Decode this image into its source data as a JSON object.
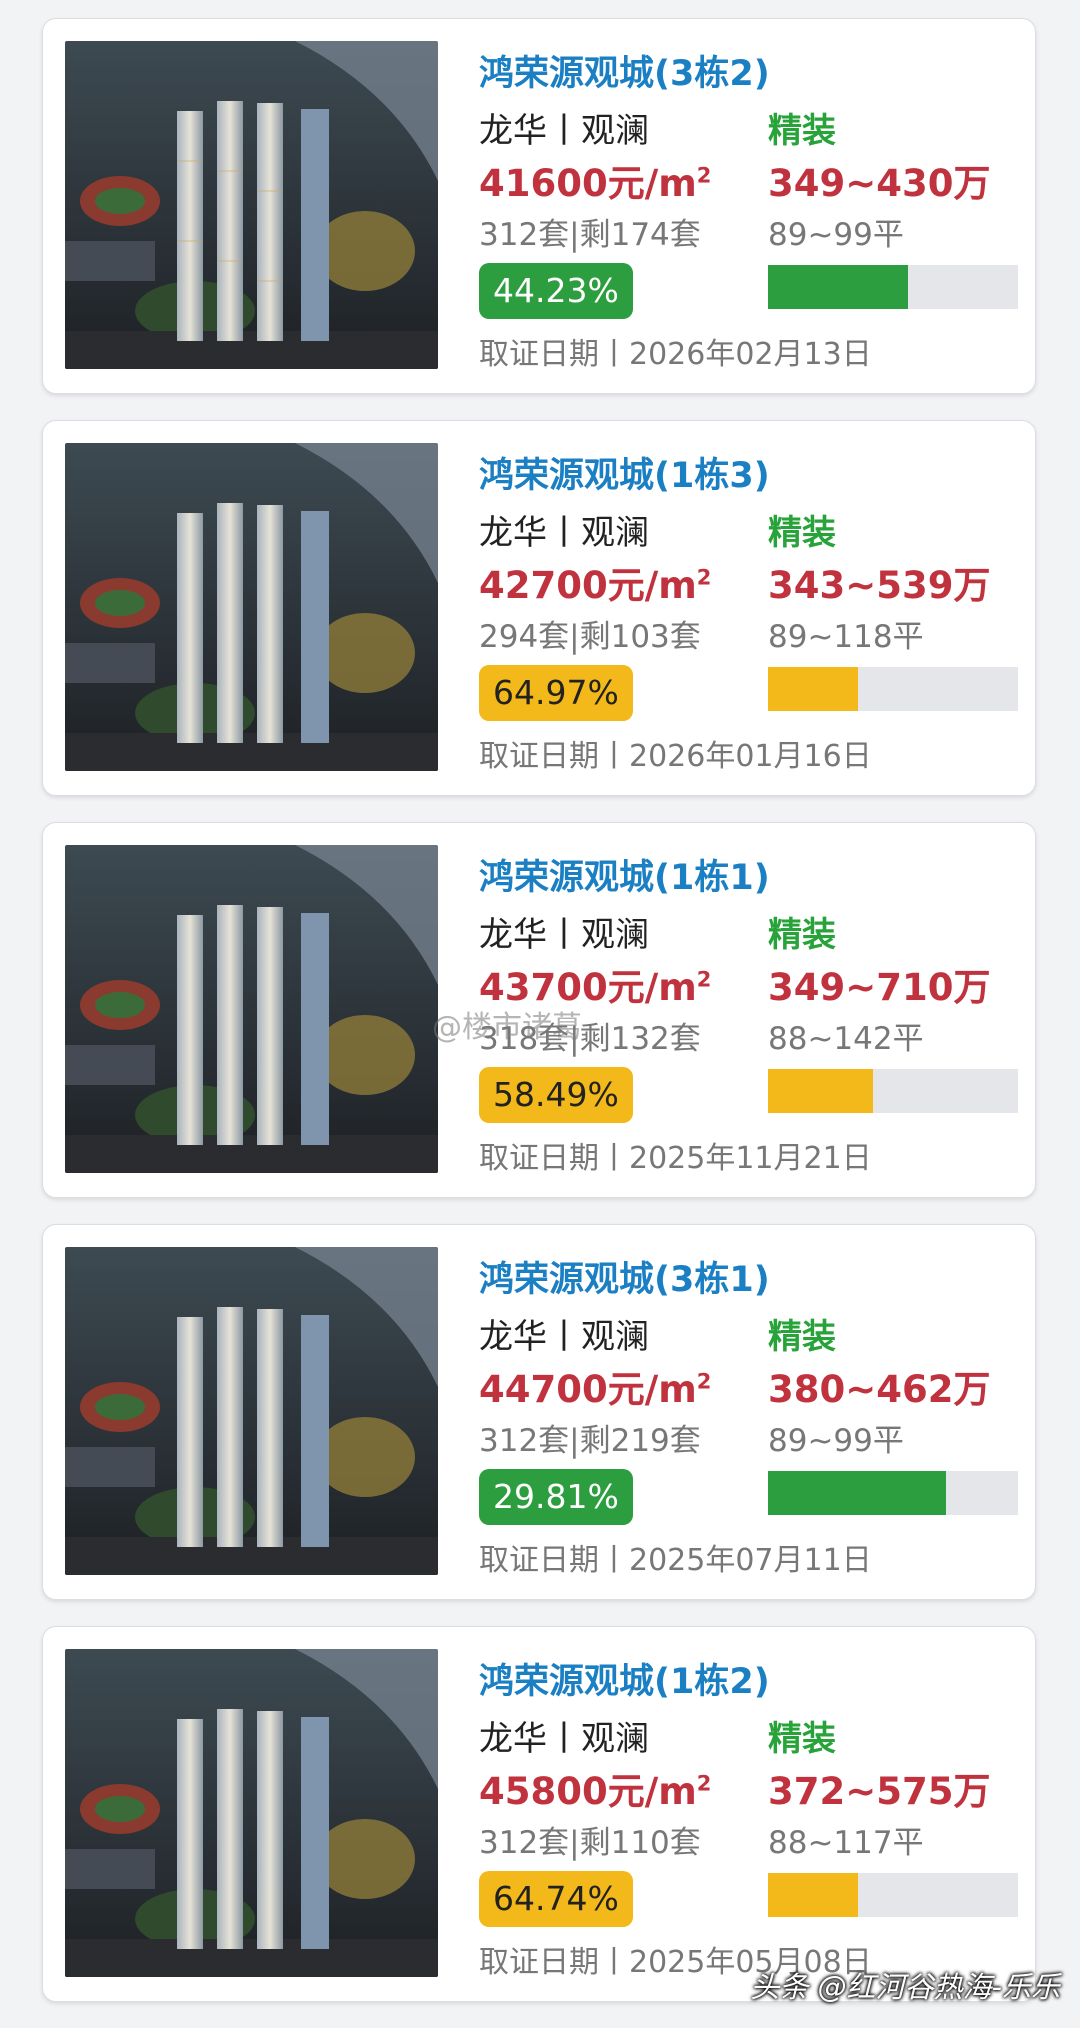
{
  "listings": [
    {
      "name": "鸿荣源观城(3栋2)",
      "location": "龙华丨观澜",
      "decoration": "精装",
      "price": "41600元/m",
      "price_unit_sup": "2",
      "total": "349~430万",
      "units": "312套|剩174套",
      "area": "89~99平",
      "rate": "44.23%",
      "rate_value": 0.56,
      "rate_color": "green",
      "date": "取证日期丨2026年02月13日"
    },
    {
      "name": "鸿荣源观城(1栋3)",
      "location": "龙华丨观澜",
      "decoration": "精装",
      "price": "42700元/m",
      "price_unit_sup": "2",
      "total": "343~539万",
      "units": "294套|剩103套",
      "area": "89~118平",
      "rate": "64.97%",
      "rate_value": 0.36,
      "rate_color": "yellow",
      "date": "取证日期丨2026年01月16日"
    },
    {
      "name": "鸿荣源观城(1栋1)",
      "location": "龙华丨观澜",
      "decoration": "精装",
      "price": "43700元/m",
      "price_unit_sup": "2",
      "total": "349~710万",
      "units": "318套|剩132套",
      "area": "88~142平",
      "rate": "58.49%",
      "rate_value": 0.42,
      "rate_color": "yellow",
      "date": "取证日期丨2025年11月21日"
    },
    {
      "name": "鸿荣源观城(3栋1)",
      "location": "龙华丨观澜",
      "decoration": "精装",
      "price": "44700元/m",
      "price_unit_sup": "2",
      "total": "380~462万",
      "units": "312套|剩219套",
      "area": "89~99平",
      "rate": "29.81%",
      "rate_value": 0.71,
      "rate_color": "green",
      "date": "取证日期丨2025年07月11日"
    },
    {
      "name": "鸿荣源观城(1栋2)",
      "location": "龙华丨观澜",
      "decoration": "精装",
      "price": "45800元/m",
      "price_unit_sup": "2",
      "total": "372~575万",
      "units": "312套|剩110套",
      "area": "88~117平",
      "rate": "64.74%",
      "rate_value": 0.36,
      "rate_color": "yellow",
      "date": "取证日期丨2025年05月08日"
    }
  ],
  "colors": {
    "green": "#2d9e3f",
    "yellow": "#f3b91a",
    "name_blue": "#1b7fc4",
    "price_red": "#c0323d"
  },
  "watermark": "@楼市诸葛",
  "footer_credit": "头条 @红河谷热海-乐乐",
  "icons": {
    "thumbnail": "building-rendering-image"
  }
}
